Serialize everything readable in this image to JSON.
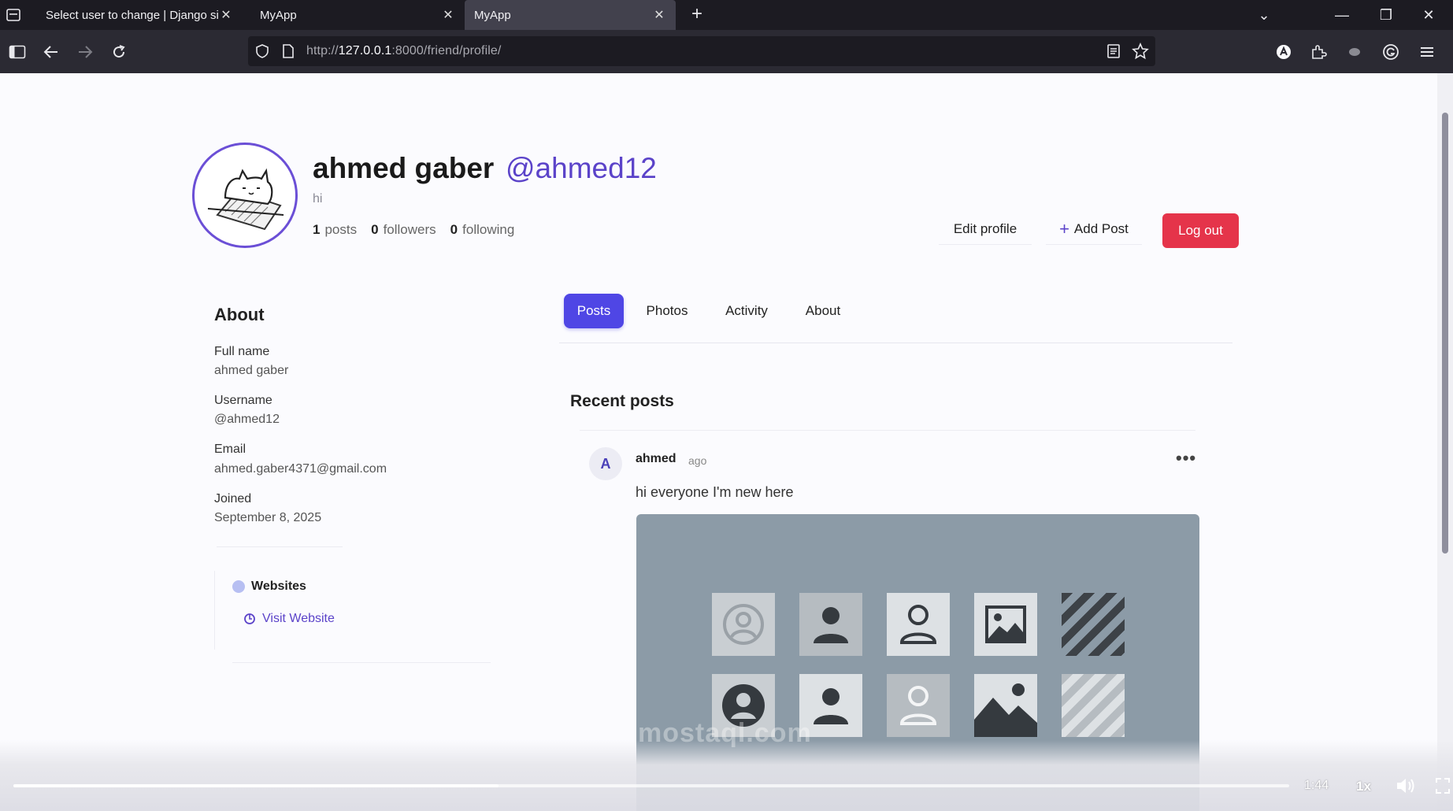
{
  "browser": {
    "tabs": [
      {
        "title": "Select user to change | Django site admin",
        "close": "✕"
      },
      {
        "title": "MyApp",
        "close": "✕"
      },
      {
        "title": "MyApp",
        "close": "✕"
      }
    ],
    "new_tab": "+",
    "window_controls": {
      "list": "⌄",
      "minimize": "—",
      "restore": "❐",
      "close": "✕"
    },
    "url_prefix": "http://",
    "url_host": "127.0.0.1",
    "url_path": ":8000/friend/profile/"
  },
  "profile": {
    "name": "ahmed gaber",
    "handle": "@ahmed12",
    "bio": "hi",
    "posts_count": "1",
    "posts_label": "posts",
    "followers_count": "0",
    "followers_label": "followers",
    "following_count": "0",
    "following_label": "following",
    "edit_label": "Edit profile",
    "add_post_label": "Add Post",
    "add_post_icon": "+",
    "logout_label": "Log out"
  },
  "about": {
    "title": "About",
    "fields": [
      {
        "label": "Full name",
        "value": "ahmed gaber"
      },
      {
        "label": "Username",
        "value": "@ahmed12"
      },
      {
        "label": "Email",
        "value": "ahmed.gaber4371@gmail.com"
      },
      {
        "label": "Joined",
        "value": "September 8, 2025"
      }
    ],
    "websites_title": "Websites",
    "visit_label": "Visit Website"
  },
  "tabs": [
    {
      "label": "Posts",
      "active": true
    },
    {
      "label": "Photos",
      "active": false
    },
    {
      "label": "Activity",
      "active": false
    },
    {
      "label": "About",
      "active": false
    }
  ],
  "recent": {
    "title": "Recent posts",
    "post": {
      "avatar_letter": "A",
      "author": "ahmed",
      "time": "ago",
      "menu": "•••",
      "text": "hi everyone I'm new here"
    }
  },
  "video": {
    "time": "1:44",
    "speed": "1x",
    "progress_fraction": 0.38
  },
  "watermark": "mostaql.com",
  "colors": {
    "accent": "#4f46e5",
    "handle": "#5b43c9",
    "danger": "#e5344a"
  }
}
